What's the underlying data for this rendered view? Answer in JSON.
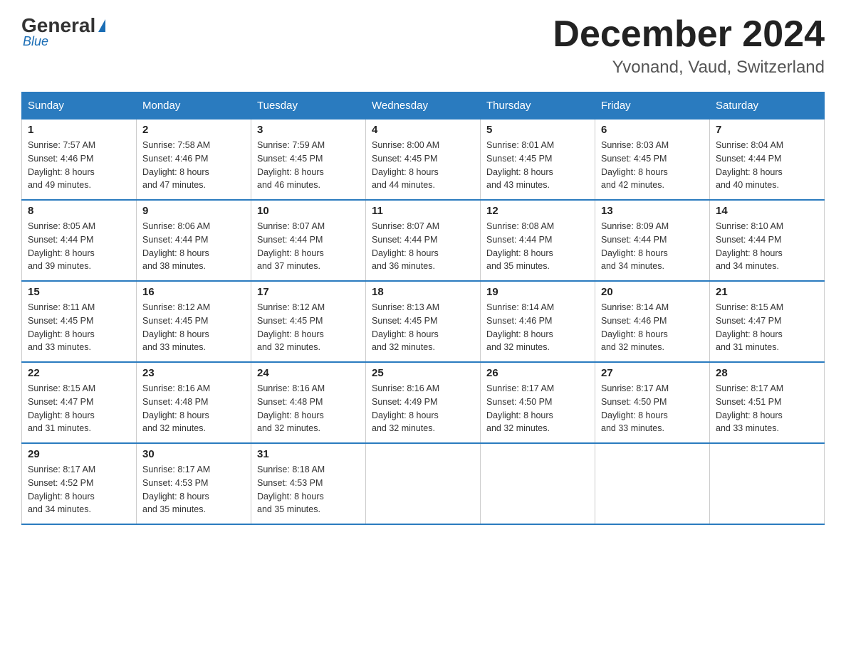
{
  "header": {
    "logo_general": "General",
    "logo_blue": "Blue",
    "month_title": "December 2024",
    "location": "Yvonand, Vaud, Switzerland"
  },
  "columns": [
    "Sunday",
    "Monday",
    "Tuesday",
    "Wednesday",
    "Thursday",
    "Friday",
    "Saturday"
  ],
  "weeks": [
    [
      {
        "day": "1",
        "sunrise": "7:57 AM",
        "sunset": "4:46 PM",
        "daylight": "8 hours and 49 minutes."
      },
      {
        "day": "2",
        "sunrise": "7:58 AM",
        "sunset": "4:46 PM",
        "daylight": "8 hours and 47 minutes."
      },
      {
        "day": "3",
        "sunrise": "7:59 AM",
        "sunset": "4:45 PM",
        "daylight": "8 hours and 46 minutes."
      },
      {
        "day": "4",
        "sunrise": "8:00 AM",
        "sunset": "4:45 PM",
        "daylight": "8 hours and 44 minutes."
      },
      {
        "day": "5",
        "sunrise": "8:01 AM",
        "sunset": "4:45 PM",
        "daylight": "8 hours and 43 minutes."
      },
      {
        "day": "6",
        "sunrise": "8:03 AM",
        "sunset": "4:45 PM",
        "daylight": "8 hours and 42 minutes."
      },
      {
        "day": "7",
        "sunrise": "8:04 AM",
        "sunset": "4:44 PM",
        "daylight": "8 hours and 40 minutes."
      }
    ],
    [
      {
        "day": "8",
        "sunrise": "8:05 AM",
        "sunset": "4:44 PM",
        "daylight": "8 hours and 39 minutes."
      },
      {
        "day": "9",
        "sunrise": "8:06 AM",
        "sunset": "4:44 PM",
        "daylight": "8 hours and 38 minutes."
      },
      {
        "day": "10",
        "sunrise": "8:07 AM",
        "sunset": "4:44 PM",
        "daylight": "8 hours and 37 minutes."
      },
      {
        "day": "11",
        "sunrise": "8:07 AM",
        "sunset": "4:44 PM",
        "daylight": "8 hours and 36 minutes."
      },
      {
        "day": "12",
        "sunrise": "8:08 AM",
        "sunset": "4:44 PM",
        "daylight": "8 hours and 35 minutes."
      },
      {
        "day": "13",
        "sunrise": "8:09 AM",
        "sunset": "4:44 PM",
        "daylight": "8 hours and 34 minutes."
      },
      {
        "day": "14",
        "sunrise": "8:10 AM",
        "sunset": "4:44 PM",
        "daylight": "8 hours and 34 minutes."
      }
    ],
    [
      {
        "day": "15",
        "sunrise": "8:11 AM",
        "sunset": "4:45 PM",
        "daylight": "8 hours and 33 minutes."
      },
      {
        "day": "16",
        "sunrise": "8:12 AM",
        "sunset": "4:45 PM",
        "daylight": "8 hours and 33 minutes."
      },
      {
        "day": "17",
        "sunrise": "8:12 AM",
        "sunset": "4:45 PM",
        "daylight": "8 hours and 32 minutes."
      },
      {
        "day": "18",
        "sunrise": "8:13 AM",
        "sunset": "4:45 PM",
        "daylight": "8 hours and 32 minutes."
      },
      {
        "day": "19",
        "sunrise": "8:14 AM",
        "sunset": "4:46 PM",
        "daylight": "8 hours and 32 minutes."
      },
      {
        "day": "20",
        "sunrise": "8:14 AM",
        "sunset": "4:46 PM",
        "daylight": "8 hours and 32 minutes."
      },
      {
        "day": "21",
        "sunrise": "8:15 AM",
        "sunset": "4:47 PM",
        "daylight": "8 hours and 31 minutes."
      }
    ],
    [
      {
        "day": "22",
        "sunrise": "8:15 AM",
        "sunset": "4:47 PM",
        "daylight": "8 hours and 31 minutes."
      },
      {
        "day": "23",
        "sunrise": "8:16 AM",
        "sunset": "4:48 PM",
        "daylight": "8 hours and 32 minutes."
      },
      {
        "day": "24",
        "sunrise": "8:16 AM",
        "sunset": "4:48 PM",
        "daylight": "8 hours and 32 minutes."
      },
      {
        "day": "25",
        "sunrise": "8:16 AM",
        "sunset": "4:49 PM",
        "daylight": "8 hours and 32 minutes."
      },
      {
        "day": "26",
        "sunrise": "8:17 AM",
        "sunset": "4:50 PM",
        "daylight": "8 hours and 32 minutes."
      },
      {
        "day": "27",
        "sunrise": "8:17 AM",
        "sunset": "4:50 PM",
        "daylight": "8 hours and 33 minutes."
      },
      {
        "day": "28",
        "sunrise": "8:17 AM",
        "sunset": "4:51 PM",
        "daylight": "8 hours and 33 minutes."
      }
    ],
    [
      {
        "day": "29",
        "sunrise": "8:17 AM",
        "sunset": "4:52 PM",
        "daylight": "8 hours and 34 minutes."
      },
      {
        "day": "30",
        "sunrise": "8:17 AM",
        "sunset": "4:53 PM",
        "daylight": "8 hours and 35 minutes."
      },
      {
        "day": "31",
        "sunrise": "8:18 AM",
        "sunset": "4:53 PM",
        "daylight": "8 hours and 35 minutes."
      },
      null,
      null,
      null,
      null
    ]
  ]
}
